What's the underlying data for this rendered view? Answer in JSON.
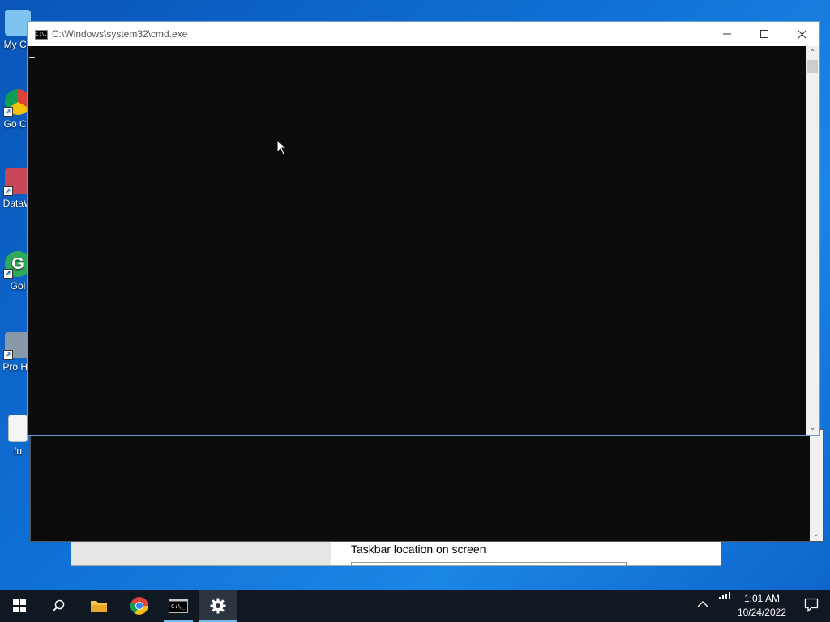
{
  "desktop": {
    "icons": [
      {
        "label": "My Co"
      },
      {
        "label": "Go Ch"
      },
      {
        "label": "DataW"
      },
      {
        "label": "Gol"
      },
      {
        "label": "Pro Ha"
      },
      {
        "label": "fu"
      }
    ]
  },
  "settings_window": {
    "taskbar_location_label": "Taskbar location on screen"
  },
  "cmd_window": {
    "title": "C:\\Windows\\system32\\cmd.exe",
    "icon_text": "C:\\."
  },
  "taskbar": {
    "time": "1:01 AM",
    "date": "10/24/2022",
    "accent": "#76b9ed",
    "items": [
      {
        "name": "start",
        "icon": "windows-logo-icon"
      },
      {
        "name": "search",
        "icon": "search-icon"
      },
      {
        "name": "file-explorer",
        "icon": "folder-icon"
      },
      {
        "name": "chrome",
        "icon": "chrome-icon"
      },
      {
        "name": "cmd",
        "icon": "cmd-icon"
      },
      {
        "name": "settings",
        "icon": "gear-icon"
      }
    ]
  }
}
